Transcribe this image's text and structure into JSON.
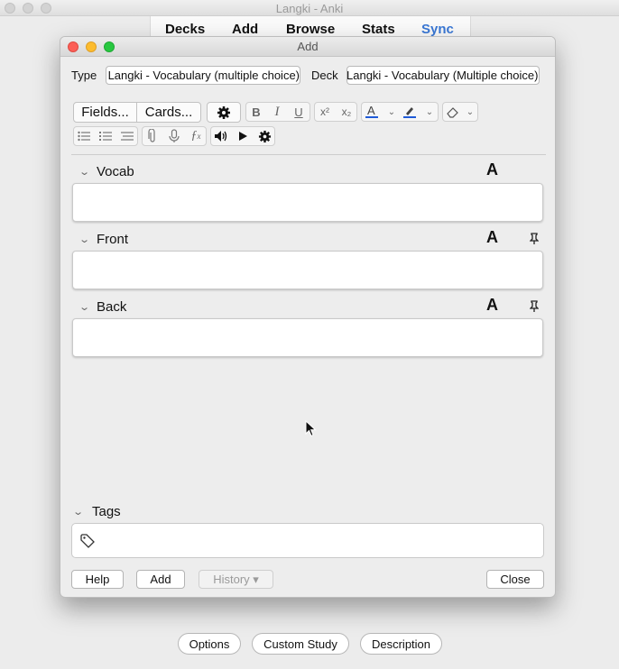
{
  "main_window": {
    "title": "Langki - Anki",
    "toolbar": [
      "Decks",
      "Add",
      "Browse",
      "Stats",
      "Sync"
    ],
    "bottom_buttons": [
      "Options",
      "Custom Study",
      "Description"
    ]
  },
  "dialog": {
    "title": "Add",
    "type_label": "Type",
    "type_value": "Langki - Vocabulary (multiple choice)",
    "deck_label": "Deck",
    "deck_value": "Langki - Vocabulary (Multiple choice)",
    "fields_button": "Fields...",
    "cards_button": "Cards...",
    "fields": [
      {
        "label": "Vocab",
        "value": "",
        "pinnable": false
      },
      {
        "label": "Front",
        "value": "",
        "pinnable": true
      },
      {
        "label": "Back",
        "value": "",
        "pinnable": true
      }
    ],
    "font_glyph": "A",
    "tags_label": "Tags",
    "tags_value": "",
    "buttons": {
      "help": "Help",
      "add": "Add",
      "history": "History ▾",
      "close": "Close"
    },
    "colors": {
      "text_color_bar": "#1f5bd8",
      "highlight_color_bar": "#1f5bd8"
    }
  }
}
